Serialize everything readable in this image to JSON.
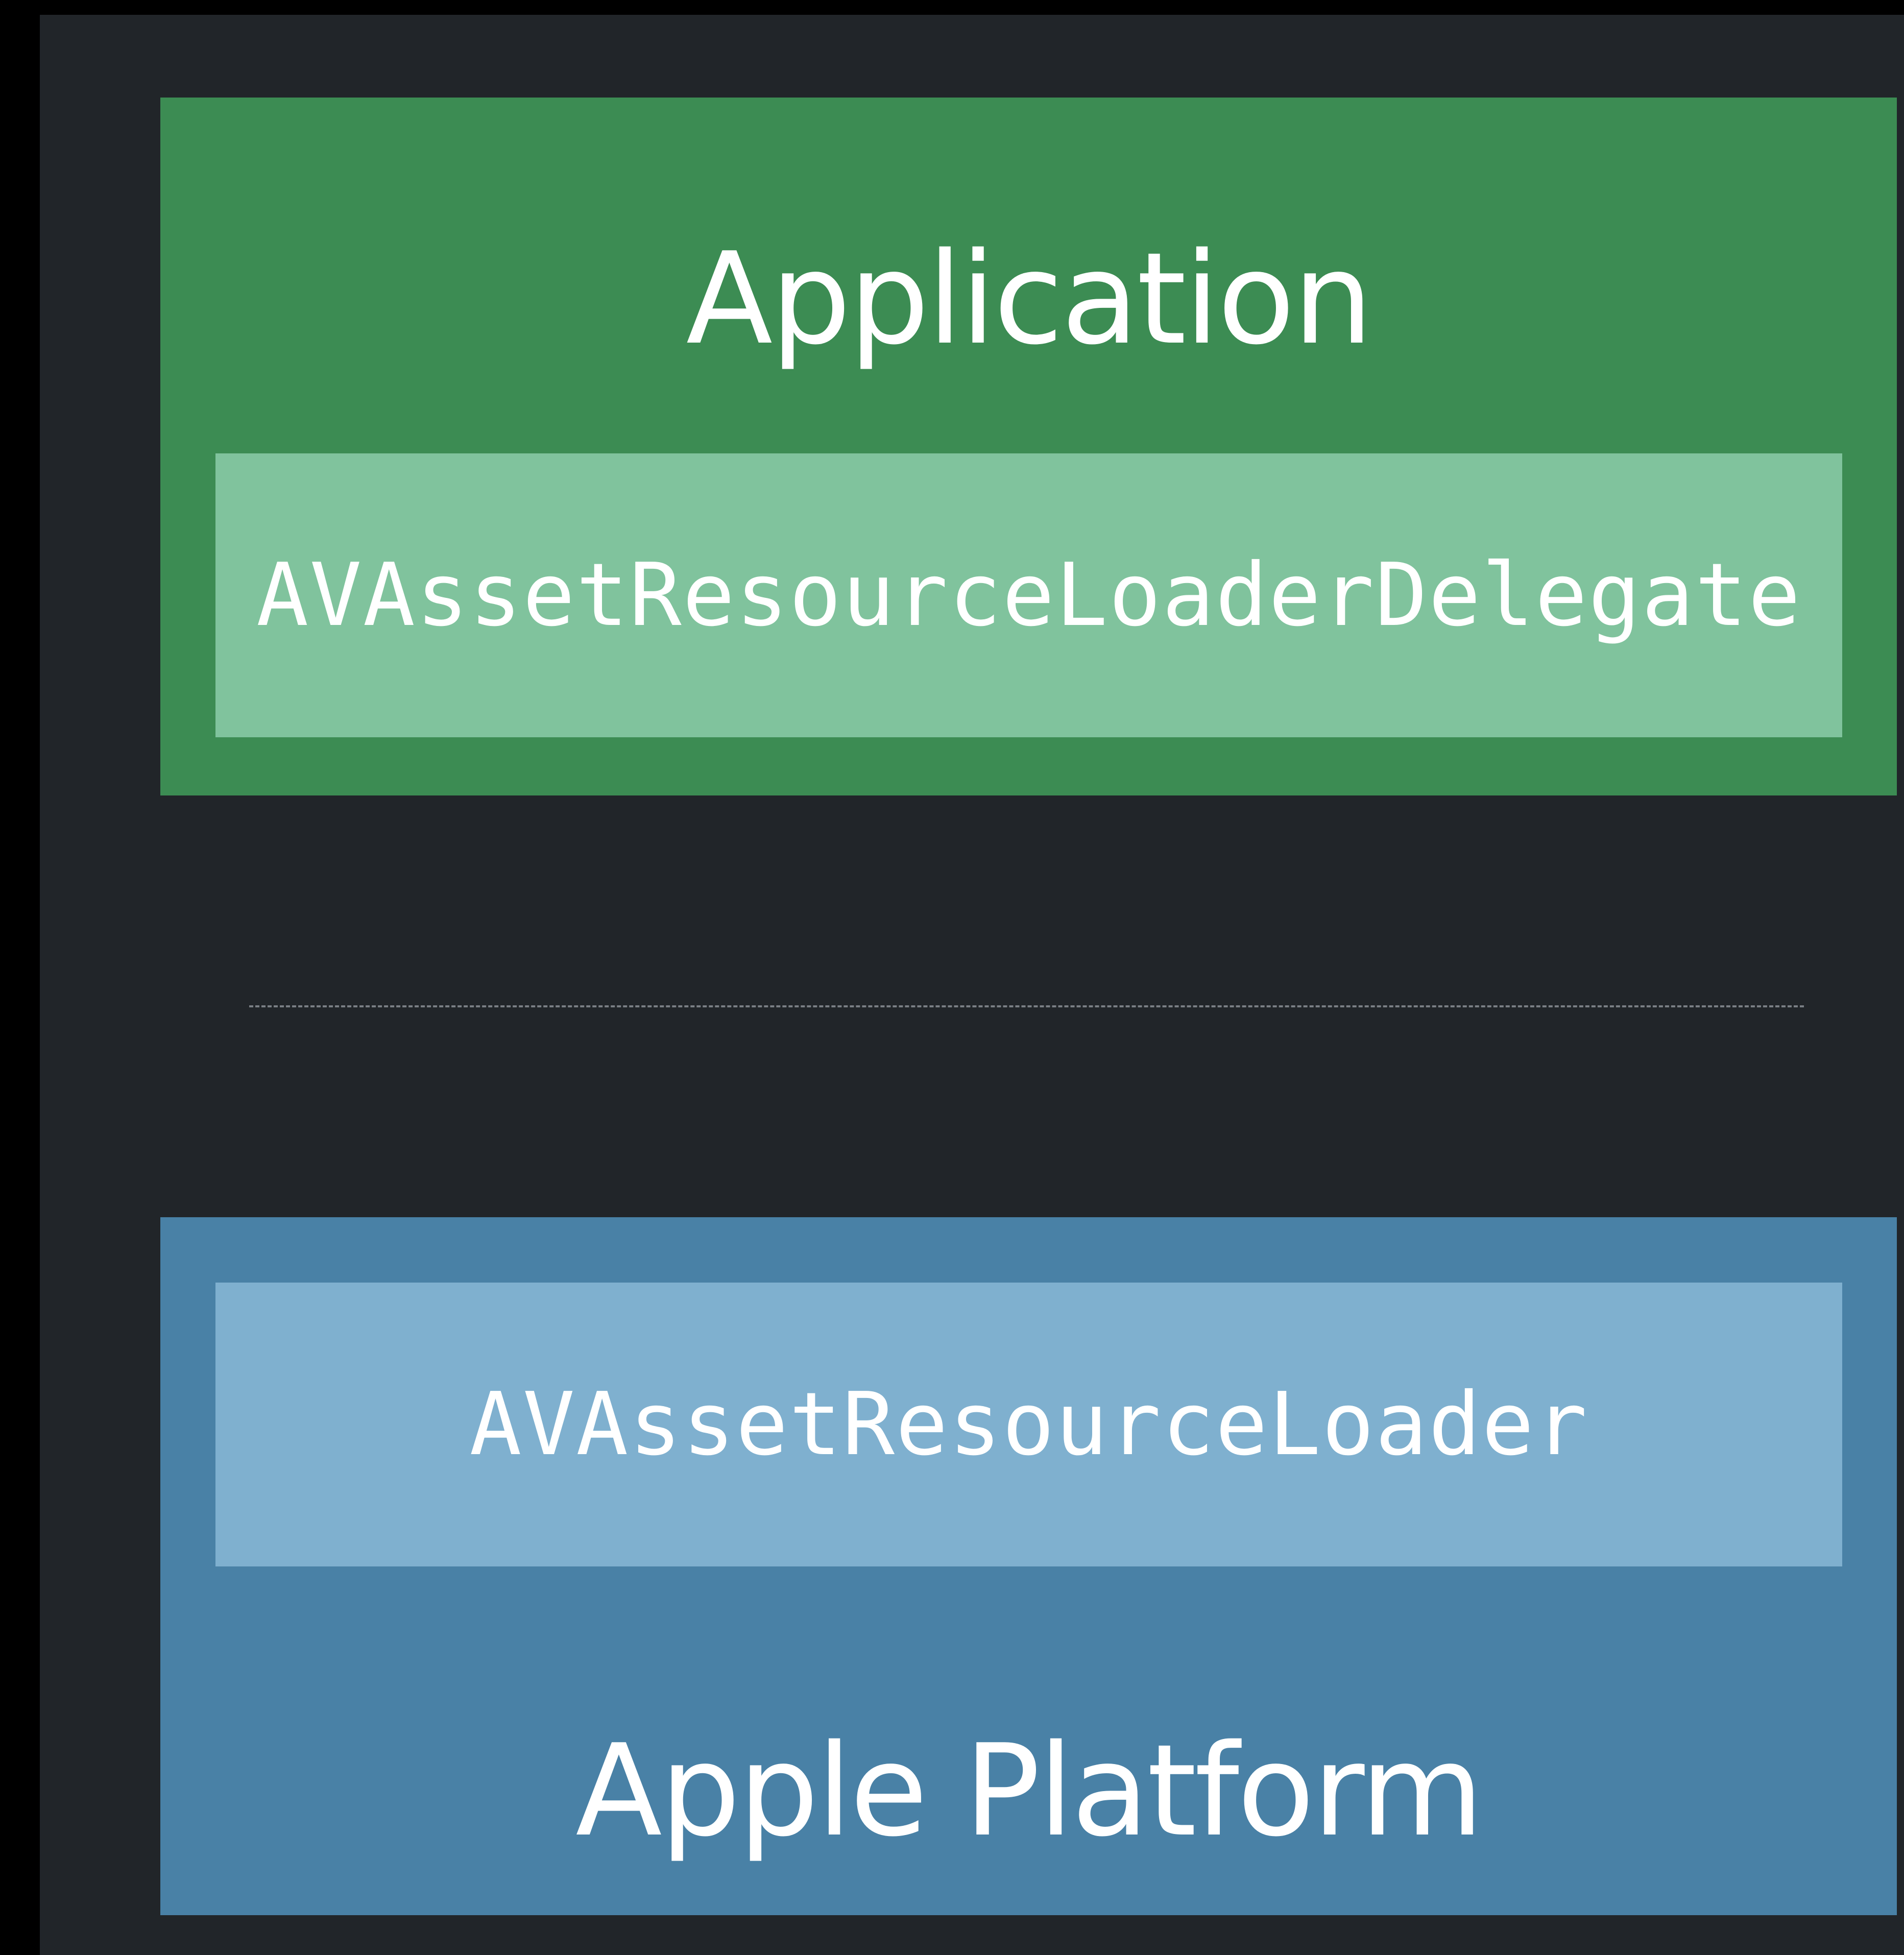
{
  "colors": {
    "outer_background": "#000000",
    "panel_background": "#212529",
    "application_layer": "#3c8c53",
    "application_component": "#80c39d",
    "platform_layer": "#4981a6",
    "platform_component": "#7fb0cf",
    "separator": "#7a7f84",
    "text": "#ffffff"
  },
  "application": {
    "title": "Application",
    "component": "AVAssetResourceLoaderDelegate"
  },
  "platform": {
    "component": "AVAssetResourceLoader",
    "title": "Apple Platform"
  }
}
